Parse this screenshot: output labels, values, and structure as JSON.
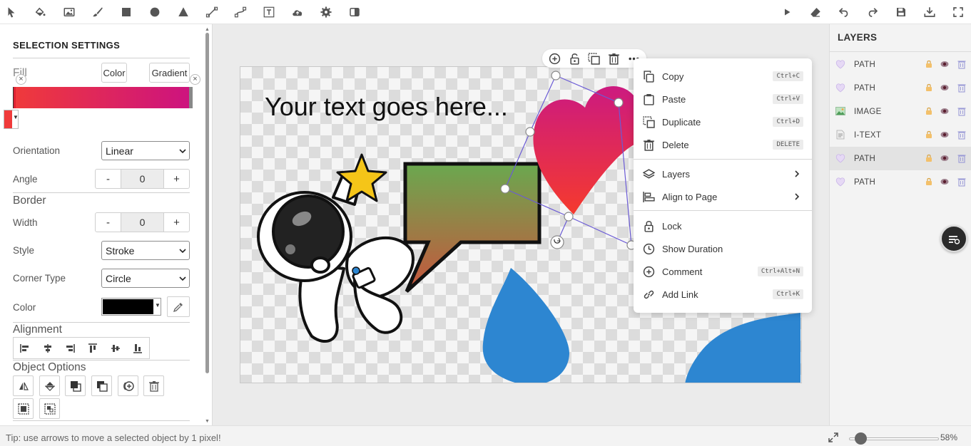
{
  "toolbar": {
    "left_icons": [
      "select-icon",
      "fill-icon",
      "image-icon",
      "brush-icon",
      "rectangle-icon",
      "circle-icon",
      "triangle-icon",
      "line-icon",
      "path-icon",
      "text-icon",
      "upload-icon",
      "settings-icon",
      "theme-icon"
    ],
    "right_icons": [
      "play-icon",
      "eraser-icon",
      "undo-icon",
      "redo-icon",
      "save-icon",
      "download-icon",
      "fullscreen-icon"
    ]
  },
  "left_panel": {
    "title": "SELECTION SETTINGS",
    "fill": {
      "label": "Fill",
      "color_button": "Color",
      "gradient_button": "Gradient",
      "gradient_start": "#f03a3a",
      "gradient_end": "#cc1280"
    },
    "orientation": {
      "label": "Orientation",
      "value": "Linear"
    },
    "angle": {
      "label": "Angle",
      "value": "0",
      "minus": "-",
      "plus": "+"
    },
    "border": {
      "heading": "Border",
      "width": {
        "label": "Width",
        "value": "0",
        "minus": "-",
        "plus": "+"
      },
      "style": {
        "label": "Style",
        "value": "Stroke"
      },
      "corner_type": {
        "label": "Corner Type",
        "value": "Circle"
      },
      "color": {
        "label": "Color",
        "value": "#000000"
      }
    },
    "alignment": {
      "heading": "Alignment"
    },
    "object_options": {
      "heading": "Object Options"
    }
  },
  "canvas": {
    "text": "Your text goes here...",
    "heart_gradient_top": "#cc1a80",
    "heart_gradient_bottom": "#f53a2d",
    "bubble_gradient_top": "#6aa84f",
    "bubble_gradient_bottom": "#c8553d",
    "drop_color": "#2d86d1"
  },
  "context_menu": {
    "items": [
      {
        "label": "Copy",
        "shortcut": "Ctrl+C"
      },
      {
        "label": "Paste",
        "shortcut": "Ctrl+V"
      },
      {
        "label": "Duplicate",
        "shortcut": "Ctrl+D"
      },
      {
        "label": "Delete",
        "shortcut": "DELETE"
      },
      {
        "label": "Layers"
      },
      {
        "label": "Align to Page"
      },
      {
        "label": "Lock"
      },
      {
        "label": "Show Duration"
      },
      {
        "label": "Comment",
        "shortcut": "Ctrl+Alt+N"
      },
      {
        "label": "Add Link",
        "shortcut": "Ctrl+K"
      }
    ]
  },
  "layers": {
    "title": "LAYERS",
    "items": [
      {
        "name": "PATH",
        "selected": false
      },
      {
        "name": "PATH",
        "selected": false
      },
      {
        "name": "IMAGE",
        "selected": false
      },
      {
        "name": "I-TEXT",
        "selected": false
      },
      {
        "name": "PATH",
        "selected": true
      },
      {
        "name": "PATH",
        "selected": false
      }
    ]
  },
  "status": {
    "tip": "Tip: use arrows to move a selected object by 1 pixel!",
    "zoom": "58%",
    "zoom_fraction": 0.13
  }
}
